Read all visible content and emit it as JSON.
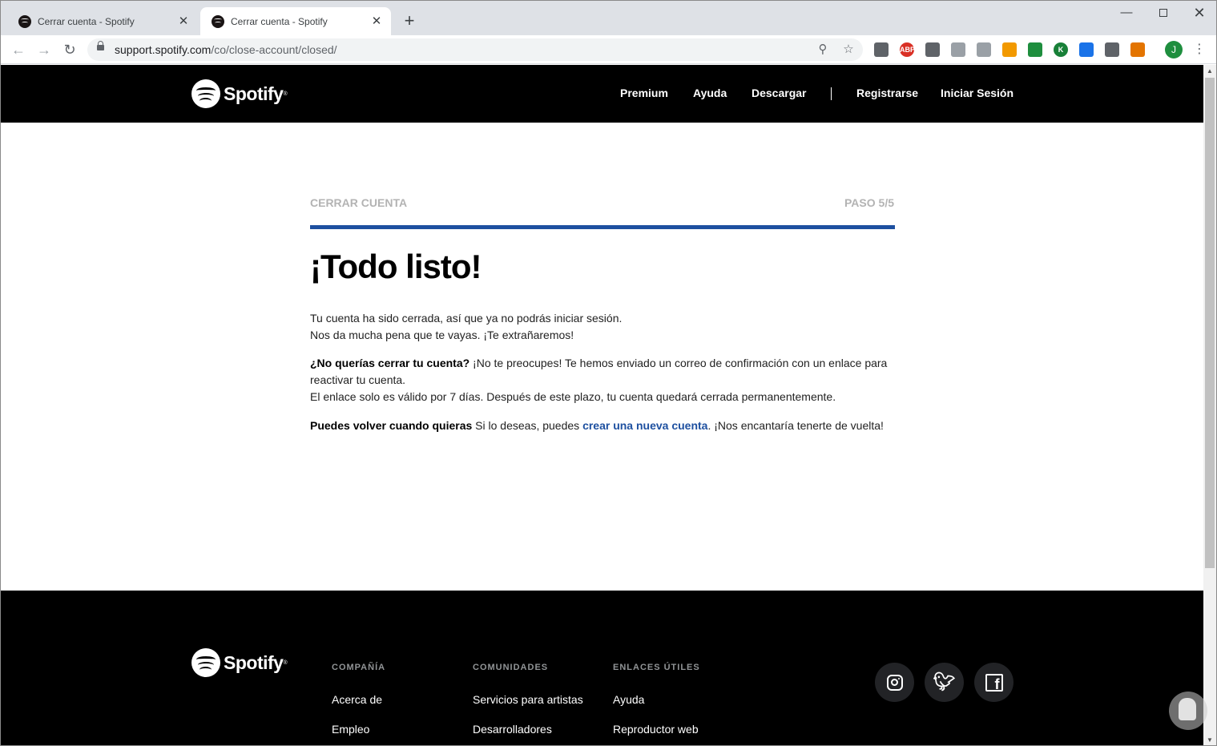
{
  "browser": {
    "tabs": [
      {
        "title": "Cerrar cuenta - Spotify",
        "active": false
      },
      {
        "title": "Cerrar cuenta - Spotify",
        "active": true
      }
    ],
    "address": {
      "host": "support.spotify.com",
      "path": "/co/close-account/closed/"
    },
    "profile_initial": "J",
    "extensions": [
      {
        "name": "extension-icon",
        "color": "#5f6368",
        "label": ""
      },
      {
        "name": "adblock-icon",
        "color": "#d93025",
        "label": "ABP"
      },
      {
        "name": "extension-icon",
        "color": "#5f6368",
        "label": ""
      },
      {
        "name": "extension-icon",
        "color": "#9aa0a6",
        "label": ""
      },
      {
        "name": "extension-icon",
        "color": "#9aa0a6",
        "label": ""
      },
      {
        "name": "extension-icon",
        "color": "#f29900",
        "label": ""
      },
      {
        "name": "extension-icon",
        "color": "#1e8e3e",
        "label": ""
      },
      {
        "name": "extension-icon",
        "color": "#188038",
        "label": "K"
      },
      {
        "name": "extension-icon",
        "color": "#1a73e8",
        "label": ""
      },
      {
        "name": "extension-icon",
        "color": "#5f6368",
        "label": ""
      },
      {
        "name": "extension-icon",
        "color": "#e37400",
        "label": ""
      }
    ]
  },
  "header": {
    "logo": "Spotify",
    "nav": {
      "premium": "Premium",
      "help": "Ayuda",
      "download": "Descargar",
      "register": "Registrarse",
      "login": "Iniciar Sesión"
    }
  },
  "main": {
    "step_label": "CERRAR CUENTA",
    "step_count": "PASO 5/5",
    "progress": 1.0,
    "headline": "¡Todo listo!",
    "p1_line1": "Tu cuenta ha sido cerrada, así que ya no podrás iniciar sesión.",
    "p1_line2": "Nos da mucha pena que te vayas. ¡Te extrañaremos!",
    "p2_bold": "¿No querías cerrar tu cuenta?",
    "p2_text": " ¡No te preocupes! Te hemos enviado un correo de confirmación con un enlace para reactivar tu cuenta.",
    "p2_line2": "El enlace solo es válido por 7 días. Después de este plazo, tu cuenta quedará cerrada permanentemente.",
    "p3_bold": "Puedes volver cuando quieras",
    "p3_text": " Si lo deseas, puedes ",
    "p3_link": "crear una nueva cuenta",
    "p3_end": ". ¡Nos encantaría tenerte de vuelta!"
  },
  "footer": {
    "logo": "Spotify",
    "columns": [
      {
        "heading": "COMPAÑÍA",
        "links": [
          "Acerca de",
          "Empleo"
        ]
      },
      {
        "heading": "COMUNIDADES",
        "links": [
          "Servicios para artistas",
          "Desarrolladores"
        ]
      },
      {
        "heading": "ENLACES ÚTILES",
        "links": [
          "Ayuda",
          "Reproductor web"
        ]
      }
    ]
  }
}
